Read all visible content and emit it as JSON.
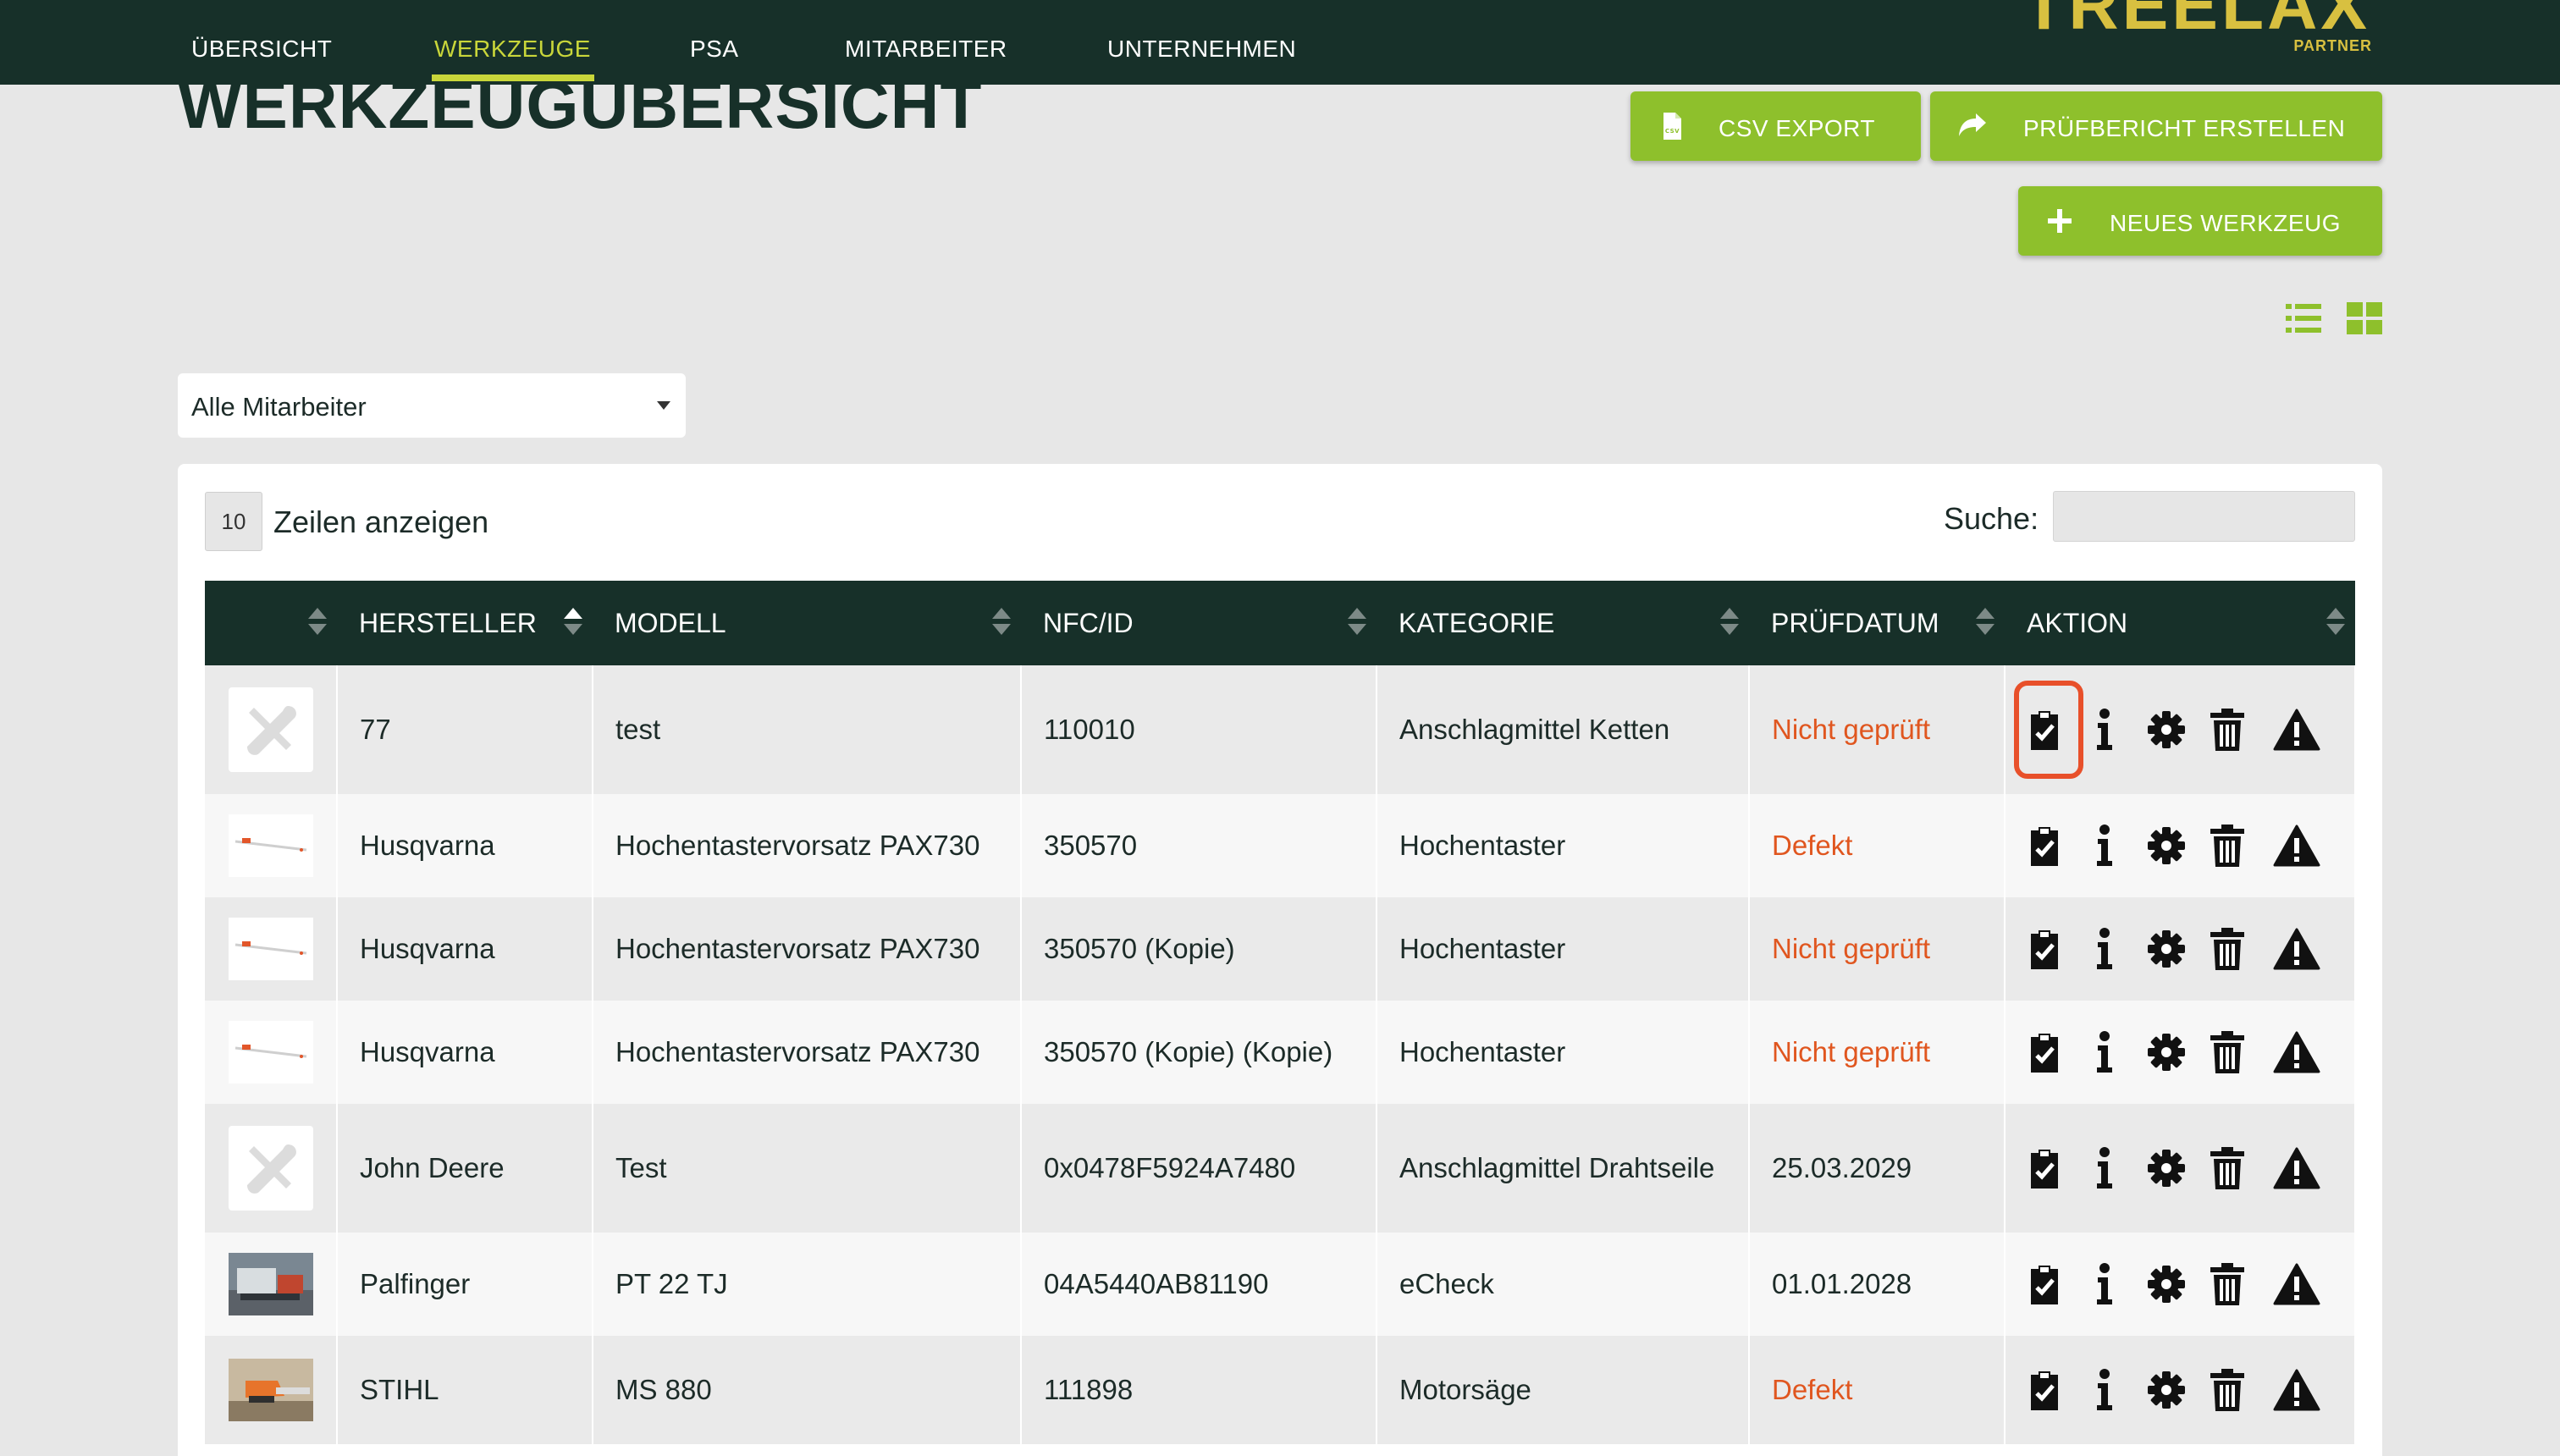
{
  "nav": {
    "items": [
      {
        "label": "ÜBERSICHT"
      },
      {
        "label": "WERKZEUGE"
      },
      {
        "label": "PSA"
      },
      {
        "label": "MITARBEITER"
      },
      {
        "label": "UNTERNEHMEN"
      }
    ],
    "active": "WERKZEUGE"
  },
  "logo": {
    "word": "TREELAX",
    "sub": "PARTNER"
  },
  "page": {
    "title": "WERKZEUGÜBERSICHT"
  },
  "toolbar": {
    "csv_label": "CSV EXPORT",
    "report_label": "PRÜFBERICHT ERSTELLEN",
    "new_label": "NEUES WERKZEUG",
    "view_modes": [
      "list-view",
      "grid-view"
    ]
  },
  "filter": {
    "employee_selected": "Alle Mitarbeiter"
  },
  "table": {
    "length_value": "10",
    "length_label": "Zeilen anzeigen",
    "search_label": "Suche:",
    "search_value": "",
    "columns": [
      "",
      "HERSTELLER",
      "MODELL",
      "NFC/ID",
      "KATEGORIE",
      "PRÜFDATUM",
      "AKTION"
    ],
    "sorted_column": "HERSTELLER",
    "rows": [
      {
        "image": "tools-placeholder-icon",
        "hersteller": "77",
        "modell": "test",
        "nfc": "110010",
        "kategorie": "Anschlagmittel Ketten",
        "pruefdatum": "Nicht geprüft",
        "status": "red"
      },
      {
        "image": "pole-pruner-photo",
        "hersteller": "Husqvarna",
        "modell": "Hochentastervorsatz PAX730",
        "nfc": "350570",
        "kategorie": "Hochentaster",
        "pruefdatum": "Defekt",
        "status": "red"
      },
      {
        "image": "pole-pruner-photo",
        "hersteller": "Husqvarna",
        "modell": "Hochentastervorsatz PAX730",
        "nfc": "350570 (Kopie)",
        "kategorie": "Hochentaster",
        "pruefdatum": "Nicht geprüft",
        "status": "red"
      },
      {
        "image": "pole-pruner-photo",
        "hersteller": "Husqvarna",
        "modell": "Hochentastervorsatz PAX730",
        "nfc": "350570 (Kopie) (Kopie)",
        "kategorie": "Hochentaster",
        "pruefdatum": "Nicht geprüft",
        "status": "red"
      },
      {
        "image": "tools-placeholder-icon",
        "hersteller": "John Deere",
        "modell": "Test",
        "nfc": "0x0478F5924A7480",
        "kategorie": "Anschlagmittel Drahtseile",
        "pruefdatum": "25.03.2029",
        "status": "ok"
      },
      {
        "image": "crane-photo",
        "hersteller": "Palfinger",
        "modell": "PT 22 TJ",
        "nfc": "04A5440AB81190",
        "kategorie": "eCheck",
        "pruefdatum": "01.01.2028",
        "status": "ok"
      },
      {
        "image": "chainsaw-photo",
        "hersteller": "STIHL",
        "modell": "MS 880",
        "nfc": "111898",
        "kategorie": "Motorsäge",
        "pruefdatum": "Defekt",
        "status": "red"
      }
    ],
    "row_actions": [
      "inspection-check-icon",
      "info-icon",
      "gear-icon",
      "trash-icon",
      "warning-icon"
    ],
    "highlighted_action": {
      "row": 0,
      "action": "inspection-check-icon"
    }
  },
  "colors": {
    "nav_bg": "#173029",
    "nav_active": "#c9d63a",
    "accent_green": "#8ec02c",
    "status_red": "#e0561f",
    "highlight": "#e8502a"
  }
}
